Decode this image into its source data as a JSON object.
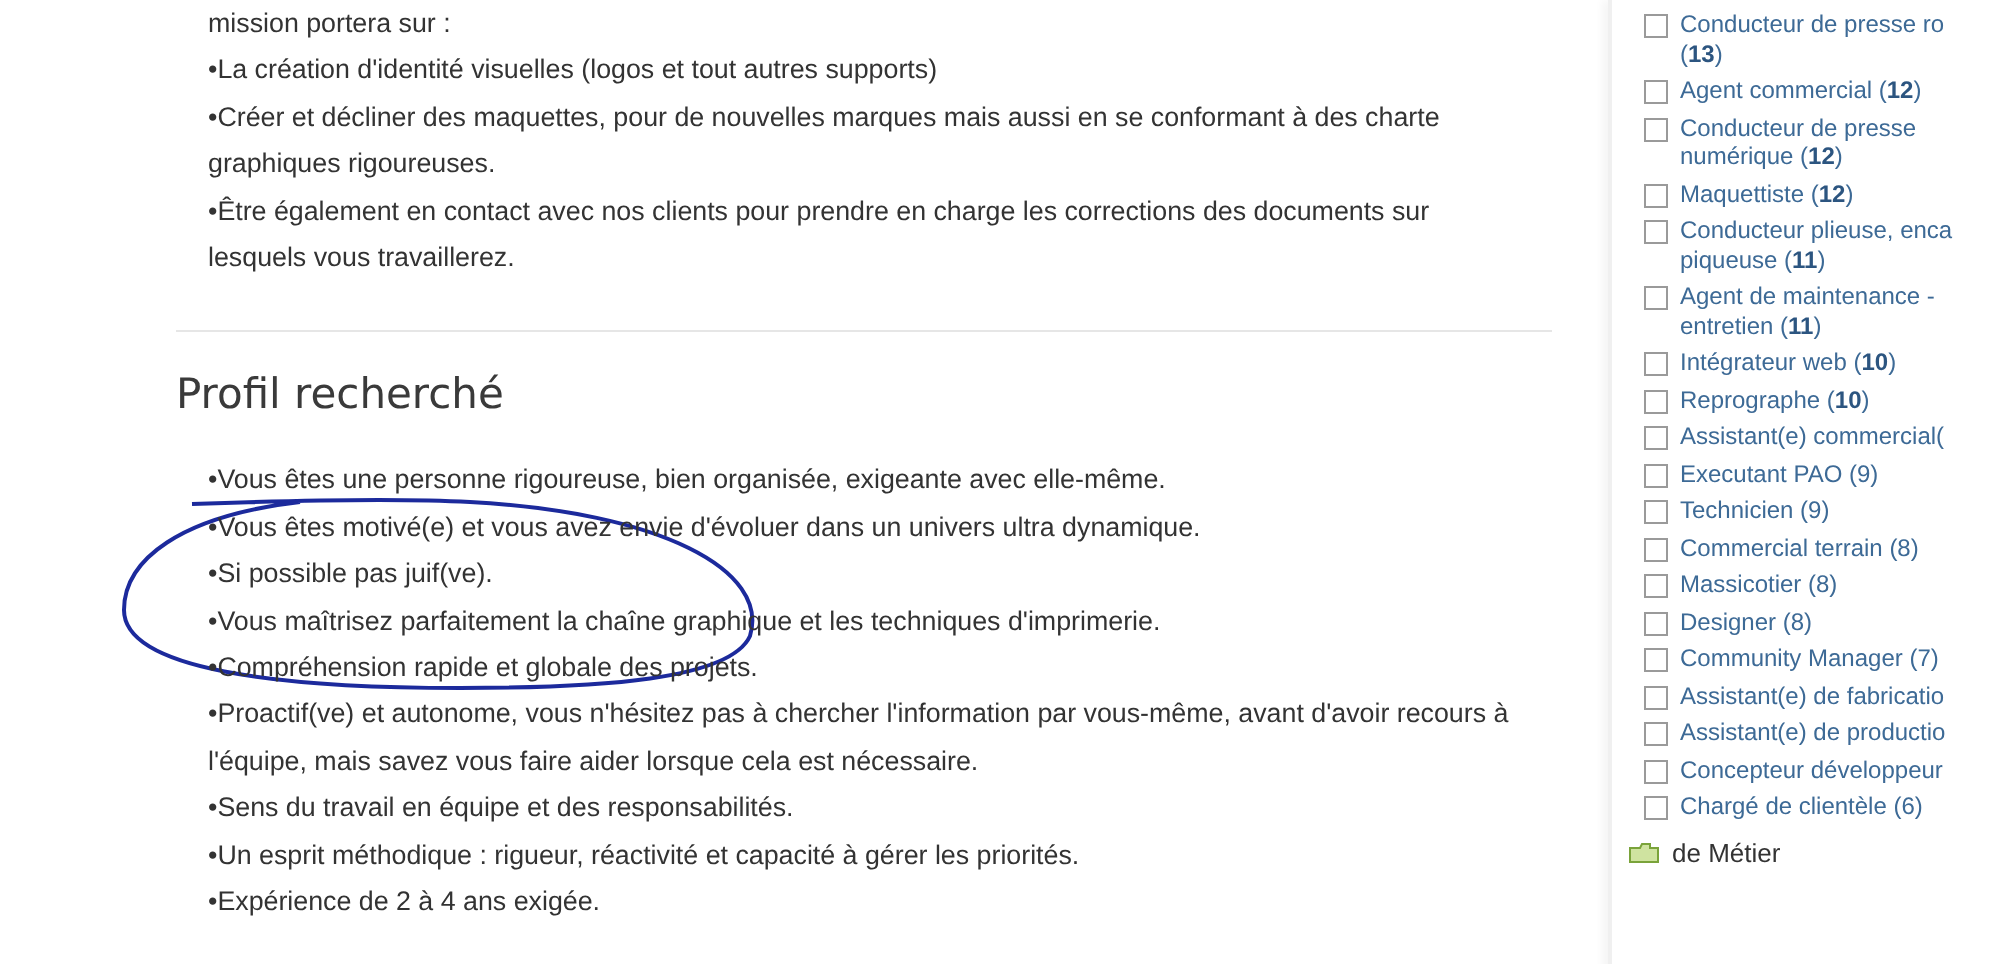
{
  "mission": {
    "intro": "mission portera sur :",
    "items": [
      "•La création d'identité visuelles (logos et tout autres supports)",
      "•Créer et décliner des maquettes, pour de nouvelles marques mais aussi en se conformant à des charte graphiques rigoureuses.",
      "•Être également en contact avec nos clients pour prendre en charge les corrections des documents sur lesquels vous travaillerez."
    ]
  },
  "profile": {
    "heading": "Profil recherché",
    "items": [
      "•Vous êtes une personne rigoureuse, bien organisée, exigeante avec elle-même.",
      "•Vous êtes motivé(e) et vous avez envie d'évoluer dans un univers ultra dynamique.",
      "•Si possible pas juif(ve).",
      "•Vous maîtrisez parfaitement la chaîne graphique et les techniques d'imprimerie.",
      "•Compréhension rapide et globale des projets.",
      "•Proactif(ve) et autonome, vous n'hésitez pas à chercher l'information par vous-même, avant d'avoir recours à l'équipe, mais savez vous faire aider lorsque cela est nécessaire.",
      "•Sens du travail en équipe et des responsabilités.",
      "•Un esprit méthodique : rigueur, réactivité et capacité à gérer les priorités.",
      "•Expérience de 2 à 4 ans exigée."
    ]
  },
  "filters": {
    "items": [
      {
        "label": "Conducteur de presse ro (**13**)",
        "checked": false
      },
      {
        "label": "Agent commercial (**12**)",
        "checked": false
      },
      {
        "label": "Conducteur de presse numérique (**12**)",
        "checked": false
      },
      {
        "label": "Maquettiste (**12**)",
        "checked": false
      },
      {
        "label": "Conducteur plieuse, enca piqueuse (**11**)",
        "checked": false
      },
      {
        "label": "Agent de maintenance - entretien (**11**)",
        "checked": false
      },
      {
        "label": "Intégrateur web (**10**)",
        "checked": false
      },
      {
        "label": "Reprographe (**10**)",
        "checked": false
      },
      {
        "label": "Assistant(e) commercial(",
        "checked": false
      },
      {
        "label": "Executant PAO (9)",
        "checked": false
      },
      {
        "label": "Technicien (9)",
        "checked": false
      },
      {
        "label": "Commercial terrain (8)",
        "checked": false
      },
      {
        "label": "Massicotier (8)",
        "checked": false
      },
      {
        "label": "Designer (8)",
        "checked": false
      },
      {
        "label": "Community Manager (7)",
        "checked": false
      },
      {
        "label": "Assistant(e) de fabricatio",
        "checked": false
      },
      {
        "label": "Assistant(e) de productio",
        "checked": false
      },
      {
        "label": "Concepteur développeur",
        "checked": false
      },
      {
        "label": "Chargé de clientèle (6)",
        "checked": false
      }
    ],
    "more": "de Métier"
  }
}
